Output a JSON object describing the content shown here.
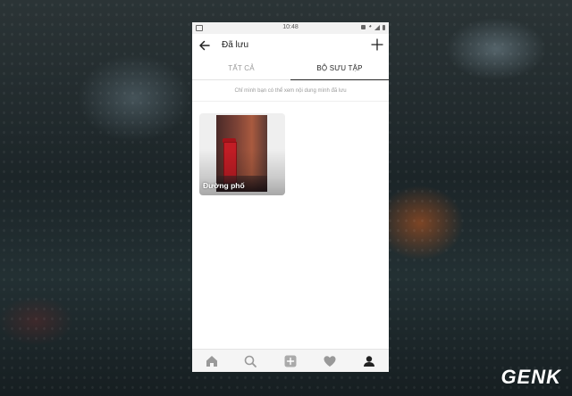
{
  "statusbar": {
    "time": "10:48"
  },
  "header": {
    "title": "Đã lưu"
  },
  "tabs": [
    {
      "label": "TẤT CẢ",
      "active": false
    },
    {
      "label": "BỘ SƯU TẬP",
      "active": true
    }
  ],
  "notice": "Chỉ mình bạn có thể xem nội dung mình đã lưu",
  "collections": [
    {
      "label": "Đường phố"
    }
  ],
  "bottom_nav": [
    "home-icon",
    "search-icon",
    "add-icon",
    "heart-icon",
    "profile-icon"
  ],
  "watermark": "GENK",
  "colors": {
    "tab_active": "#262626",
    "tab_inactive": "#999999",
    "booth_red": "#c21d25"
  }
}
